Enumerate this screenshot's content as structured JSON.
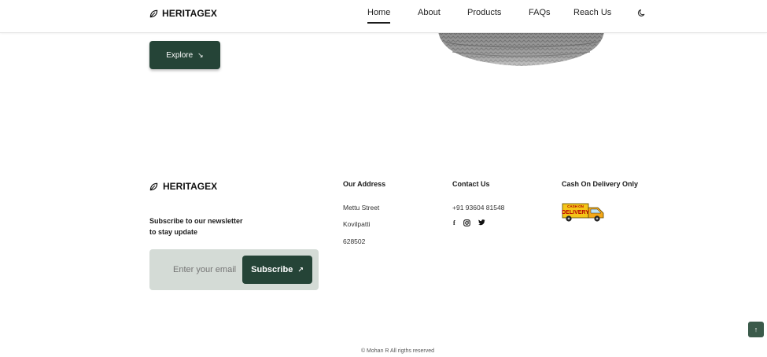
{
  "nav": {
    "brand": "HERITAGEX",
    "links": [
      "Home",
      "About",
      "Products",
      "FAQs",
      "Reach Us"
    ],
    "active": "Home"
  },
  "hero": {
    "explore_label": "Explore"
  },
  "footer": {
    "brand": "HERITAGEX",
    "newsletter_line1": "Subscribe to our newsletter",
    "newsletter_line2": "to stay update",
    "email_placeholder": "Enter your email",
    "subscribe_label": "Subscribe",
    "address": {
      "heading": "Our Address",
      "lines": [
        "Mettu Street",
        "Kovilpatti",
        "628502"
      ]
    },
    "contact": {
      "heading": "Contact Us",
      "phone": "+91 93604 81548",
      "socials": [
        "facebook-icon",
        "instagram-icon",
        "twitter-icon"
      ]
    },
    "delivery": {
      "heading": "Cash On Delivery Only",
      "badge_top": "CASH ON",
      "badge_bottom": "DELIVERY"
    },
    "copyright": "© Mohan R All rigths reserved"
  },
  "colors": {
    "primary": "#254437",
    "input_bg": "#d4dbd6",
    "scroll_top": "#3b5a4a"
  }
}
